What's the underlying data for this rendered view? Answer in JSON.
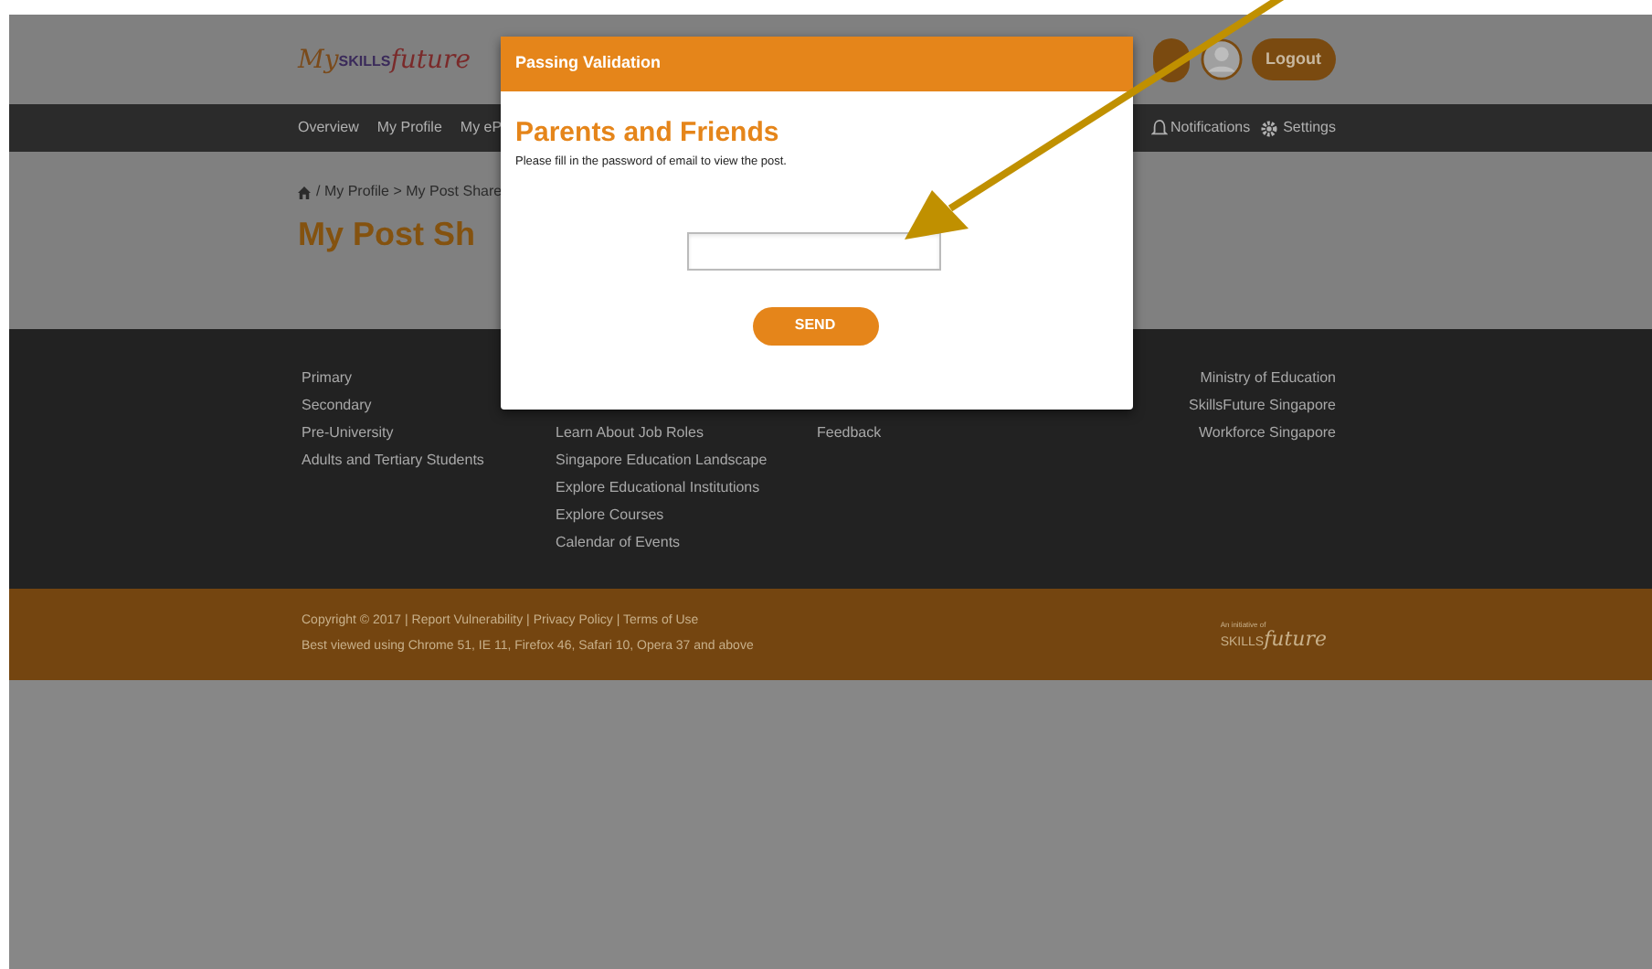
{
  "header": {
    "logo": {
      "my": "My",
      "skills": "SKILLS",
      "future": "future"
    },
    "logout_button": "Logout"
  },
  "nav": {
    "items": [
      "Overview",
      "My Profile",
      "My eP"
    ],
    "notifications": "Notifications",
    "settings": "Settings"
  },
  "breadcrumb": "/ My Profile > My Post Share",
  "page_title": "My Post Sh",
  "footer": {
    "columns": [
      [
        "Primary",
        "Secondary",
        "Pre-University",
        "Adults and Tertiary Students"
      ],
      [
        "Learn About Job Roles",
        "Singapore Education Landscape",
        "Explore Educational Institutions",
        "Explore Courses",
        "Calendar of Events"
      ],
      [
        "Feedback"
      ],
      [
        "Ministry of Education",
        "SkillsFuture Singapore",
        "Workforce Singapore"
      ]
    ],
    "legal": "Copyright © 2017 | Report Vulnerability | Privacy Policy | Terms of Use",
    "browser_note": "Best viewed using Chrome 51, IE 11, Firefox 46, Safari 10, Opera 37 and above",
    "logo": {
      "caption": "An initiative of",
      "skills": "SKILLS",
      "future": "future"
    }
  },
  "dialog": {
    "title": "Passing Validation",
    "heading": "Parents and Friends",
    "message": "Please fill in the password of email to view the post.",
    "send_button": "SEND"
  }
}
